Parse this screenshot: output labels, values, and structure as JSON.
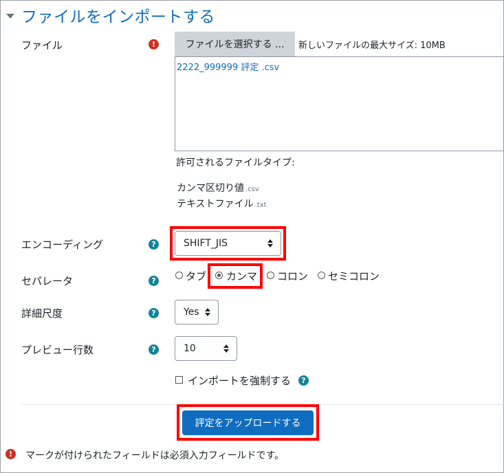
{
  "section": {
    "title": "ファイルをインポートする"
  },
  "file": {
    "label": "ファイル",
    "button_label": "ファイルを選択する ...",
    "max_size": "新しいファイルの最大サイズ: 10MB",
    "selected_file": "2222_999999 評定 .csv",
    "accepted_title": "許可されるファイルタイプ:",
    "types": [
      {
        "name": "カンマ区切り値",
        "ext": ".csv"
      },
      {
        "name": "テキストファイル",
        "ext": ".txt"
      }
    ]
  },
  "encoding": {
    "label": "エンコーディング",
    "value": "SHIFT_JIS"
  },
  "separator": {
    "label": "セパレータ",
    "options": [
      "タブ",
      "カンマ",
      "コロン",
      "セミコロン"
    ],
    "selected": "カンマ"
  },
  "verbose": {
    "label": "詳細尺度",
    "value": "Yes"
  },
  "preview_rows": {
    "label": "プレビュー行数",
    "value": "10"
  },
  "force_import": {
    "label": "インポートを強制する"
  },
  "submit": {
    "label": "評定をアップロードする"
  },
  "footnote": "マークが付けられたフィールドは必須入力フィールドです。",
  "colors": {
    "accent": "#0f6cbf",
    "required": "#ca3120",
    "help": "#10849a",
    "highlight": "#ff0000"
  }
}
